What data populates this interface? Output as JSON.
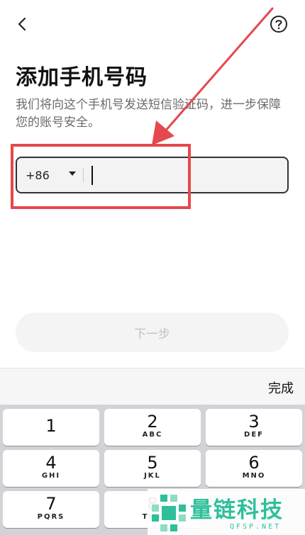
{
  "header": {
    "back_icon": "chevron-left-icon",
    "help_icon": "question-circle-icon"
  },
  "page": {
    "title": "添加手机号码",
    "subtitle": "我们将向这个手机号发送短信验证码，进一步保障您的账号安全。"
  },
  "phone": {
    "country_code": "+86",
    "value": "",
    "placeholder": ""
  },
  "annotation": {
    "color": "#e5484d"
  },
  "next_button": {
    "label": "下一步"
  },
  "keyboard": {
    "done_label": "完成",
    "keys": [
      {
        "num": "1",
        "letters": ""
      },
      {
        "num": "2",
        "letters": "ABC"
      },
      {
        "num": "3",
        "letters": "DEF"
      },
      {
        "num": "4",
        "letters": "GHI"
      },
      {
        "num": "5",
        "letters": "JKL"
      },
      {
        "num": "6",
        "letters": "MNO"
      },
      {
        "num": "7",
        "letters": "PQRS"
      },
      {
        "num": "8",
        "letters": "TUV"
      }
    ]
  },
  "watermark": {
    "text": "量链科技",
    "sub": "QFSP.NET",
    "color": "#2fbf9a"
  }
}
